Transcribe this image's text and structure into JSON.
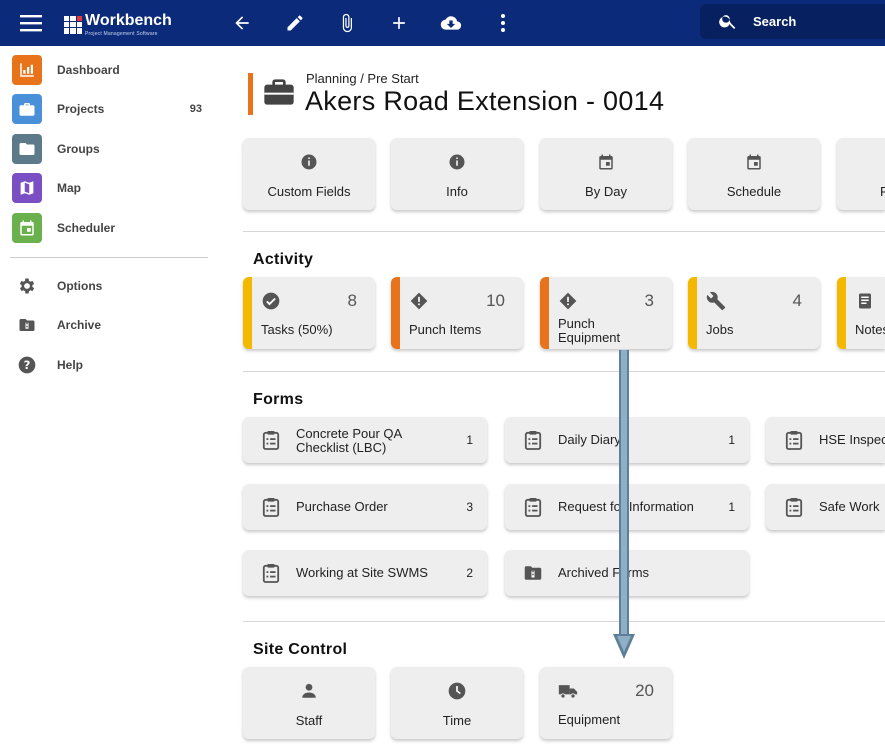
{
  "app": {
    "logo_name": "Workbench",
    "logo_sub": "Project Management Software",
    "search_label": "Search"
  },
  "sidebar": {
    "items": [
      {
        "label": "Dashboard",
        "icon": "chart-icon",
        "color": "#e8731a"
      },
      {
        "label": "Projects",
        "icon": "briefcase-icon",
        "color": "#4a90d9",
        "count": "93"
      },
      {
        "label": "Groups",
        "icon": "folder-icon",
        "color": "#5c7a8a"
      },
      {
        "label": "Map",
        "icon": "map-icon",
        "color": "#7b4fc4"
      },
      {
        "label": "Scheduler",
        "icon": "calendar-icon",
        "color": "#6ab04c"
      }
    ],
    "secondary": [
      {
        "label": "Options",
        "icon": "gear-icon"
      },
      {
        "label": "Archive",
        "icon": "archive-icon"
      },
      {
        "label": "Help",
        "icon": "help-icon"
      }
    ]
  },
  "header": {
    "breadcrumb": "Planning / Pre Start",
    "title": "Akers Road Extension - 0014",
    "accent": "#e8731a"
  },
  "top_cards": [
    {
      "label": "Custom Fields",
      "icon": "info-icon"
    },
    {
      "label": "Info",
      "icon": "info-icon"
    },
    {
      "label": "By Day",
      "icon": "calendar-icon"
    },
    {
      "label": "Schedule",
      "icon": "calendar-icon"
    },
    {
      "label": "F",
      "icon": "calendar-icon"
    }
  ],
  "activity": {
    "title": "Activity",
    "items": [
      {
        "label": "Tasks (50%)",
        "count": "8",
        "icon": "check-circle-icon",
        "stripe": "#f5b800"
      },
      {
        "label": "Punch Items",
        "count": "10",
        "icon": "warning-diamond-icon",
        "stripe": "#e8731a"
      },
      {
        "label": "Punch Equipment",
        "count": "3",
        "icon": "warning-diamond-icon",
        "stripe": "#e8731a"
      },
      {
        "label": "Jobs",
        "count": "4",
        "icon": "wrench-icon",
        "stripe": "#f5b800"
      },
      {
        "label": "Notes",
        "count": "",
        "icon": "notes-icon",
        "stripe": "#f5b800"
      }
    ]
  },
  "forms": {
    "title": "Forms",
    "items": [
      {
        "label": "Concrete Pour QA Checklist (LBC)",
        "count": "1"
      },
      {
        "label": "Daily Diary",
        "count": "1"
      },
      {
        "label": "HSE Inspection",
        "count": ""
      },
      {
        "label": "Purchase Order",
        "count": "3"
      },
      {
        "label": "Request for Information",
        "count": "1"
      },
      {
        "label": "Safe Work",
        "count": ""
      },
      {
        "label": "Working at Site SWMS",
        "count": "2"
      },
      {
        "label": "Archived Forms",
        "count": ""
      }
    ]
  },
  "site_control": {
    "title": "Site Control",
    "items": [
      {
        "label": "Staff",
        "count": "",
        "icon": "person-icon"
      },
      {
        "label": "Time",
        "count": "",
        "icon": "clock-icon"
      },
      {
        "label": "Equipment",
        "count": "20",
        "icon": "truck-icon"
      }
    ]
  }
}
